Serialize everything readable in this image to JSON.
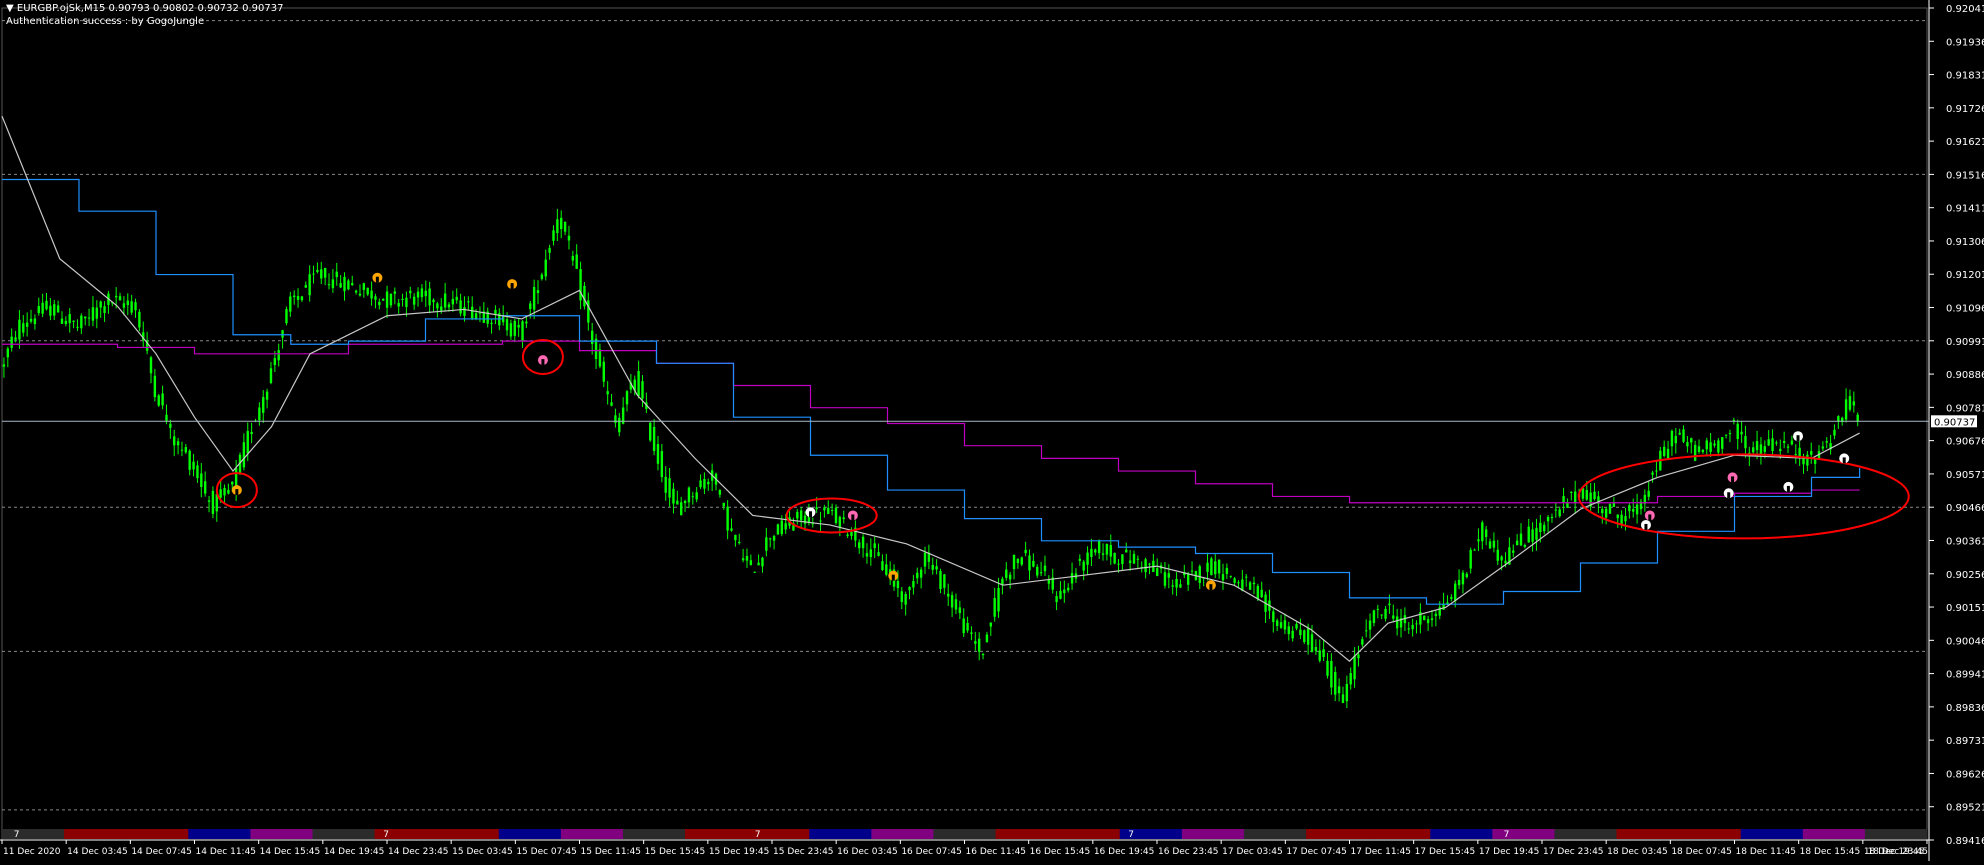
{
  "header": {
    "symbol_line": "EURGBP.ojSk,M15  0.90793 0.90802 0.90732 0.90737",
    "auth_message": "Authentication success : by GogoJungle"
  },
  "colors": {
    "background": "#000000",
    "candle": "#00ff00",
    "price_axis": "#ffffff",
    "ma_white": "#c8c8c8",
    "line_blue": "#1e90ff",
    "line_magenta": "#c000c0",
    "highlight_circle": "#ff0000",
    "arrow_orange": "#ffa500",
    "arrow_pink": "#ff69b4",
    "arrow_white": "#ffffff",
    "current_price_line": "#a9b7c6",
    "bar_blocks": [
      "#2b2b2b",
      "#8b0000",
      "#00008b",
      "#800080"
    ]
  },
  "chart_data": {
    "type": "candlestick",
    "symbol": "EURGBP.ojSk",
    "timeframe": "M15",
    "last_ohlc": {
      "open": 0.90793,
      "high": 0.90802,
      "low": 0.90732,
      "close": 0.90737
    },
    "current_price_label": "0.90737",
    "y_ticks": [
      "0.92041",
      "0.91936",
      "0.91831",
      "0.91726",
      "0.91621",
      "0.91516",
      "0.91411",
      "0.91306",
      "0.91201",
      "0.91096",
      "0.90991",
      "0.90886",
      "0.90781",
      "0.90676",
      "0.90571",
      "0.90466",
      "0.90361",
      "0.90256",
      "0.90151",
      "0.90046",
      "0.89941",
      "0.89836",
      "0.89731",
      "0.89626",
      "0.89521",
      "0.89416"
    ],
    "ylim": [
      0.89416,
      0.92041
    ],
    "x_ticks": [
      "11 Dec 2020",
      "14 Dec 03:45",
      "14 Dec 07:45",
      "14 Dec 11:45",
      "14 Dec 15:45",
      "14 Dec 19:45",
      "14 Dec 23:45",
      "15 Dec 03:45",
      "15 Dec 07:45",
      "15 Dec 11:45",
      "15 Dec 15:45",
      "15 Dec 19:45",
      "15 Dec 23:45",
      "16 Dec 03:45",
      "16 Dec 07:45",
      "16 Dec 11:45",
      "16 Dec 15:45",
      "16 Dec 19:45",
      "16 Dec 23:45",
      "17 Dec 03:45",
      "17 Dec 07:45",
      "17 Dec 11:45",
      "17 Dec 15:45",
      "17 Dec 19:45",
      "17 Dec 23:45",
      "18 Dec 03:45",
      "18 Dec 07:45",
      "18 Dec 11:45",
      "18 Dec 15:45",
      "18 Dec 19:45",
      "18 Dec 23:45"
    ],
    "horizontal_levels": [
      0.92001,
      0.91516,
      0.90991,
      0.90466,
      0.90011,
      0.89511
    ],
    "price_path": [
      [
        0,
        0.909
      ],
      [
        0.01,
        0.9104
      ],
      [
        0.025,
        0.911
      ],
      [
        0.04,
        0.9103
      ],
      [
        0.055,
        0.9112
      ],
      [
        0.07,
        0.911
      ],
      [
        0.08,
        0.9085
      ],
      [
        0.09,
        0.9068
      ],
      [
        0.1,
        0.906
      ],
      [
        0.11,
        0.9047
      ],
      [
        0.12,
        0.9052
      ],
      [
        0.13,
        0.9071
      ],
      [
        0.14,
        0.9088
      ],
      [
        0.15,
        0.911
      ],
      [
        0.165,
        0.912
      ],
      [
        0.18,
        0.9117
      ],
      [
        0.2,
        0.9112
      ],
      [
        0.22,
        0.9113
      ],
      [
        0.24,
        0.911
      ],
      [
        0.26,
        0.9106
      ],
      [
        0.27,
        0.9101
      ],
      [
        0.28,
        0.9118
      ],
      [
        0.29,
        0.914
      ],
      [
        0.3,
        0.9118
      ],
      [
        0.31,
        0.9093
      ],
      [
        0.32,
        0.9072
      ],
      [
        0.33,
        0.9088
      ],
      [
        0.34,
        0.9065
      ],
      [
        0.35,
        0.9046
      ],
      [
        0.36,
        0.9052
      ],
      [
        0.37,
        0.9057
      ],
      [
        0.38,
        0.9038
      ],
      [
        0.39,
        0.9026
      ],
      [
        0.4,
        0.9038
      ],
      [
        0.415,
        0.9043
      ],
      [
        0.43,
        0.9045
      ],
      [
        0.44,
        0.904
      ],
      [
        0.45,
        0.9034
      ],
      [
        0.46,
        0.9027
      ],
      [
        0.47,
        0.9017
      ],
      [
        0.48,
        0.9032
      ],
      [
        0.49,
        0.9022
      ],
      [
        0.5,
        0.901
      ],
      [
        0.51,
        0.9
      ],
      [
        0.52,
        0.9024
      ],
      [
        0.53,
        0.9032
      ],
      [
        0.54,
        0.9026
      ],
      [
        0.55,
        0.9018
      ],
      [
        0.56,
        0.9028
      ],
      [
        0.57,
        0.9034
      ],
      [
        0.58,
        0.9031
      ],
      [
        0.59,
        0.903
      ],
      [
        0.6,
        0.9027
      ],
      [
        0.61,
        0.9022
      ],
      [
        0.62,
        0.9025
      ],
      [
        0.63,
        0.9029
      ],
      [
        0.64,
        0.9024
      ],
      [
        0.65,
        0.9021
      ],
      [
        0.66,
        0.9012
      ],
      [
        0.67,
        0.9008
      ],
      [
        0.68,
        0.9005
      ],
      [
        0.69,
        0.8996
      ],
      [
        0.695,
        0.8985
      ],
      [
        0.7,
        0.899
      ],
      [
        0.71,
        0.901
      ],
      [
        0.72,
        0.9015
      ],
      [
        0.73,
        0.9008
      ],
      [
        0.74,
        0.9012
      ],
      [
        0.75,
        0.9015
      ],
      [
        0.76,
        0.9025
      ],
      [
        0.77,
        0.904
      ],
      [
        0.78,
        0.903
      ],
      [
        0.79,
        0.9036
      ],
      [
        0.8,
        0.904
      ],
      [
        0.81,
        0.9046
      ],
      [
        0.82,
        0.9052
      ],
      [
        0.83,
        0.9048
      ],
      [
        0.84,
        0.9044
      ],
      [
        0.85,
        0.9045
      ],
      [
        0.86,
        0.9059
      ],
      [
        0.87,
        0.907
      ],
      [
        0.88,
        0.9064
      ],
      [
        0.89,
        0.9066
      ],
      [
        0.9,
        0.9072
      ],
      [
        0.91,
        0.9064
      ],
      [
        0.92,
        0.9067
      ],
      [
        0.93,
        0.9065
      ],
      [
        0.94,
        0.9061
      ],
      [
        0.95,
        0.9068
      ],
      [
        0.96,
        0.908
      ],
      [
        0.965,
        0.9075
      ]
    ],
    "ma_white_path": [
      [
        0,
        0.917
      ],
      [
        0.03,
        0.9125
      ],
      [
        0.06,
        0.911
      ],
      [
        0.08,
        0.9095
      ],
      [
        0.1,
        0.9075
      ],
      [
        0.12,
        0.9058
      ],
      [
        0.14,
        0.9072
      ],
      [
        0.16,
        0.9095
      ],
      [
        0.2,
        0.9107
      ],
      [
        0.24,
        0.9109
      ],
      [
        0.27,
        0.9106
      ],
      [
        0.3,
        0.9115
      ],
      [
        0.33,
        0.9082
      ],
      [
        0.36,
        0.9062
      ],
      [
        0.39,
        0.9044
      ],
      [
        0.43,
        0.9041
      ],
      [
        0.47,
        0.9035
      ],
      [
        0.52,
        0.9022
      ],
      [
        0.56,
        0.9025
      ],
      [
        0.6,
        0.9028
      ],
      [
        0.64,
        0.9022
      ],
      [
        0.68,
        0.9008
      ],
      [
        0.7,
        0.8998
      ],
      [
        0.72,
        0.901
      ],
      [
        0.75,
        0.9015
      ],
      [
        0.78,
        0.9028
      ],
      [
        0.82,
        0.9046
      ],
      [
        0.86,
        0.9056
      ],
      [
        0.9,
        0.9063
      ],
      [
        0.94,
        0.9062
      ],
      [
        0.965,
        0.907
      ]
    ],
    "blue_path": [
      [
        0,
        0.915
      ],
      [
        0.04,
        0.914
      ],
      [
        0.08,
        0.912
      ],
      [
        0.12,
        0.9101
      ],
      [
        0.15,
        0.9098
      ],
      [
        0.18,
        0.9099
      ],
      [
        0.22,
        0.9106
      ],
      [
        0.26,
        0.9107
      ],
      [
        0.3,
        0.9099
      ],
      [
        0.34,
        0.9092
      ],
      [
        0.38,
        0.9075
      ],
      [
        0.42,
        0.9063
      ],
      [
        0.46,
        0.9052
      ],
      [
        0.5,
        0.9043
      ],
      [
        0.54,
        0.9036
      ],
      [
        0.58,
        0.9034
      ],
      [
        0.62,
        0.9032
      ],
      [
        0.66,
        0.9026
      ],
      [
        0.7,
        0.9018
      ],
      [
        0.74,
        0.9016
      ],
      [
        0.78,
        0.902
      ],
      [
        0.82,
        0.9029
      ],
      [
        0.86,
        0.9039
      ],
      [
        0.9,
        0.905
      ],
      [
        0.94,
        0.9056
      ],
      [
        0.965,
        0.9059
      ]
    ],
    "magenta_path": [
      [
        0,
        0.9098
      ],
      [
        0.06,
        0.9097
      ],
      [
        0.1,
        0.9095
      ],
      [
        0.14,
        0.9095
      ],
      [
        0.18,
        0.9098
      ],
      [
        0.22,
        0.9098
      ],
      [
        0.26,
        0.9099
      ],
      [
        0.3,
        0.9096
      ],
      [
        0.34,
        0.9092
      ],
      [
        0.38,
        0.9085
      ],
      [
        0.42,
        0.9078
      ],
      [
        0.46,
        0.9073
      ],
      [
        0.5,
        0.9066
      ],
      [
        0.54,
        0.9062
      ],
      [
        0.58,
        0.9058
      ],
      [
        0.62,
        0.9054
      ],
      [
        0.66,
        0.905
      ],
      [
        0.7,
        0.9048
      ],
      [
        0.74,
        0.9048
      ],
      [
        0.78,
        0.9048
      ],
      [
        0.82,
        0.9048
      ],
      [
        0.86,
        0.905
      ],
      [
        0.9,
        0.9051
      ],
      [
        0.94,
        0.9052
      ],
      [
        0.965,
        0.9052
      ]
    ],
    "highlight_circles": [
      {
        "x": 0.122,
        "y": 0.9052
      },
      {
        "x": 0.281,
        "y": 0.9094
      },
      {
        "x": 0.431,
        "y": 0.9044
      },
      {
        "x": 0.91,
        "y": 0.905
      }
    ],
    "signal_arrows": [
      {
        "x": 0.122,
        "y": 0.9052,
        "color": "orange"
      },
      {
        "x": 0.195,
        "y": 0.9119,
        "color": "orange"
      },
      {
        "x": 0.265,
        "y": 0.9117,
        "color": "orange"
      },
      {
        "x": 0.281,
        "y": 0.9093,
        "color": "pink"
      },
      {
        "x": 0.42,
        "y": 0.9045,
        "color": "white"
      },
      {
        "x": 0.442,
        "y": 0.9044,
        "color": "pink"
      },
      {
        "x": 0.463,
        "y": 0.9025,
        "color": "orange"
      },
      {
        "x": 0.628,
        "y": 0.9022,
        "color": "orange"
      },
      {
        "x": 0.854,
        "y": 0.9041,
        "color": "white"
      },
      {
        "x": 0.856,
        "y": 0.9044,
        "color": "pink"
      },
      {
        "x": 0.897,
        "y": 0.9051,
        "color": "white"
      },
      {
        "x": 0.899,
        "y": 0.9056,
        "color": "pink"
      },
      {
        "x": 0.928,
        "y": 0.9053,
        "color": "white"
      },
      {
        "x": 0.933,
        "y": 0.9069,
        "color": "white"
      },
      {
        "x": 0.957,
        "y": 0.9062,
        "color": "white"
      }
    ],
    "bottom_band": {
      "labels": [
        "7",
        "7",
        "7",
        "7",
        "7"
      ],
      "label_positions": [
        0.004,
        0.196,
        0.389,
        0.583,
        0.778
      ]
    }
  }
}
